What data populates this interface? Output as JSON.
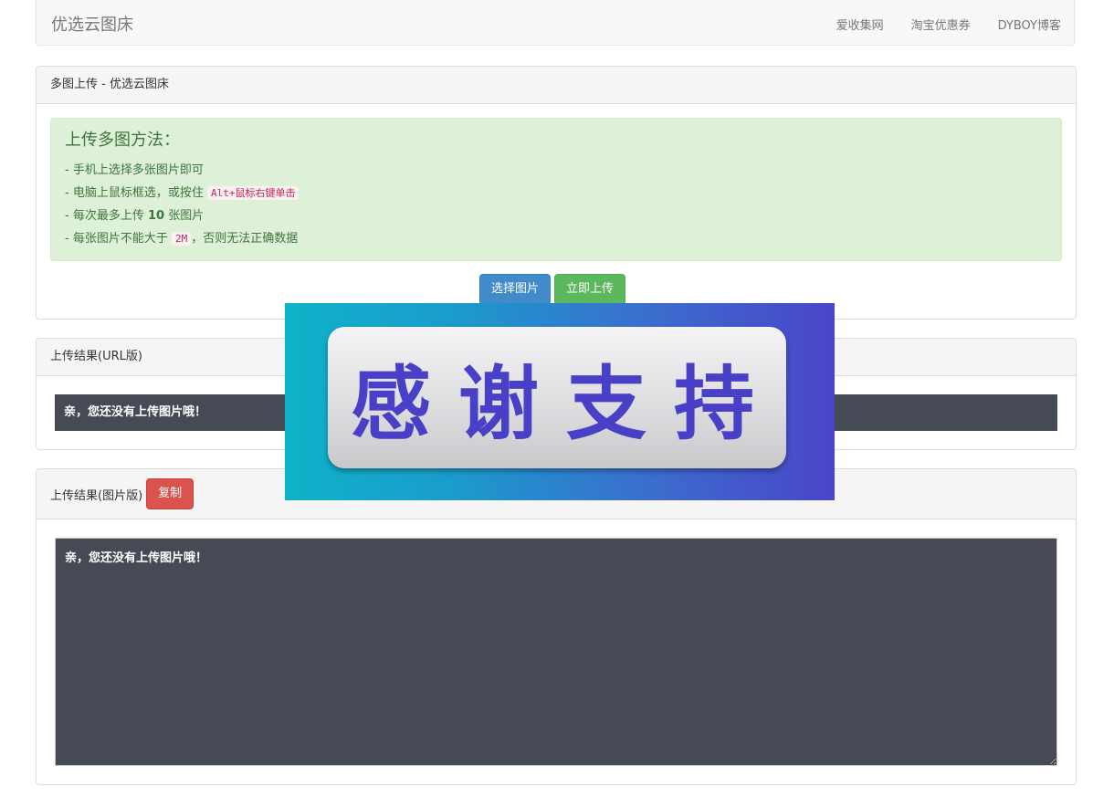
{
  "navbar": {
    "brand": "优选云图床",
    "links": [
      "爱收集网",
      "淘宝优惠券",
      "DYBOY博客"
    ]
  },
  "upload_panel": {
    "heading": "多图上传 - 优选云图床",
    "alert_title": "上传多图方法：",
    "line1": "- 手机上选择多张图片即可",
    "line2_prefix": "- 电脑上鼠标框选，或按住 ",
    "line2_code": "Alt+鼠标右键单击",
    "line3_prefix": "- 每次最多上传 ",
    "line3_bold": "10",
    "line3_suffix": " 张图片",
    "line4_prefix": "- 每张图片不能大于 ",
    "line4_code": "2M",
    "line4_suffix": "，否则无法正确数据",
    "select_button": "选择图片",
    "upload_button": "立即上传"
  },
  "url_panel": {
    "heading": "上传结果(URL版)",
    "result_text": "亲，您还没有上传图片哦！"
  },
  "image_panel": {
    "heading": "上传结果(图片版)",
    "copy_button": "复制",
    "result_text": "亲，您还没有上传图片哦！"
  },
  "overlay": {
    "text": "感谢支持"
  },
  "colors": {
    "primary": "#428bca",
    "success": "#5cb85c",
    "danger": "#d9534f",
    "alert_bg": "#dff0d8",
    "result_bg": "#454a54"
  }
}
